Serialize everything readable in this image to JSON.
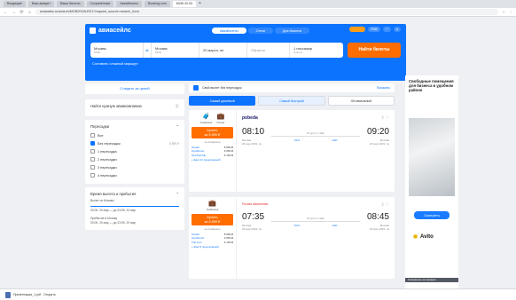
{
  "browser": {
    "tabs": [
      "Входящие",
      "Ваш аккаунт",
      "Ваши билеты",
      "Сохранённые",
      "Авиабилеты",
      "Booking.com",
      "МОВ 20.03"
    ],
    "url": "aviasales.ru/search/МОВ2003LED1?request_source=search_form"
  },
  "site": {
    "logo": "авиасейлс",
    "nav": [
      "Авиабилеты",
      "Отели",
      "Для бизнеса"
    ],
    "currency": "RUB",
    "search": {
      "from": "Москва",
      "from_code": "МОВ",
      "to": "Москва",
      "to_code": "МОВ",
      "date": "20 марта, пн",
      "return_placeholder": "Обратно",
      "passengers": "1 пассажир",
      "class": "эконом",
      "button": "Найти билеты"
    },
    "route_link": "Составить сложный маршрут"
  },
  "filters": {
    "subscribe": "Следить за ценой",
    "airlines": {
      "title": "Найти нужную авиакомпанию"
    },
    "transfers_title": "Пересадки",
    "transfers": [
      {
        "label": "Все",
        "price": "",
        "checked": false
      },
      {
        "label": "Без пересадок",
        "price": "8 899 ₽",
        "checked": true
      },
      {
        "label": "1 пересадка",
        "price": "",
        "checked": false
      },
      {
        "label": "2 пересадки",
        "price": "",
        "checked": false
      },
      {
        "label": "3 пересадки",
        "price": "",
        "checked": false
      },
      {
        "label": "4 пересадки",
        "price": "",
        "checked": false
      }
    ],
    "times_title": "Время вылета и прибытия",
    "times": {
      "row1": "Вылет из Москвы",
      "row1_range": "00:00, 20 мар — до 23:59, 20 мар",
      "row2": "Прибытие в Москву",
      "row2_range": "00:00, 20 мар — до 23:59, 20 мар"
    }
  },
  "results": {
    "note": "Свой вылет без пересадок",
    "note_action": "Показать",
    "sorts": [
      "Самый дешёвый",
      "Самый быстрый",
      "Оптимальный"
    ],
    "tickets": [
      {
        "agencies": [
          "Aviakassa",
          "Oneair"
        ],
        "buy": "Купить",
        "price": "за 8 899 ₽",
        "via": "на Aviakassa",
        "alts": [
          {
            "name": "Oneair",
            "price": "8 999 ₽"
          },
          {
            "name": "Купибилет",
            "price": "9 050 ₽"
          },
          {
            "name": "OneTwoTrip",
            "price": "9 100 ₽"
          }
        ],
        "more": "+ Ещё 12 предложений",
        "airline": "pobeda",
        "dep": "08:10",
        "arr": "09:20",
        "duration": "В пути 1ч 10м",
        "dep_city": "Москва",
        "dep_date": "20 мар 2023, пн",
        "dep_code": "VKO",
        "arr_city": "Москва",
        "arr_date": "20 мар 2023, пн",
        "arr_code": "LED"
      },
      {
        "agencies": [
          "Aviakassa"
        ],
        "buy": "Купить",
        "price": "за 8 899 ₽",
        "via": "на Aviakassa",
        "alts": [
          {
            "name": "Oneair",
            "price": "8 999 ₽"
          },
          {
            "name": "Купибилет",
            "price": "9 050 ₽"
          },
          {
            "name": "Trip.com",
            "price": "9 100 ₽"
          }
        ],
        "more": "+ Ещё 9 предложений",
        "airline": "Россия Авиалинии",
        "dep": "07:35",
        "arr": "08:45",
        "duration": "В пути 1ч 10м",
        "dep_city": "Москва",
        "dep_date": "20 мар 2023, пн",
        "dep_code": "SVO",
        "arr_city": "Москва",
        "arr_date": "20 мар 2023, пн",
        "arr_code": "LED"
      }
    ]
  },
  "ad": {
    "text": "Свободные помещения для бизнеса в удобном районе",
    "button": "Смотреть",
    "brand": "Avito"
  },
  "toast": "Сохранено на сервере",
  "download": {
    "file": "Презентация_1.pdf",
    "sub": "Открыть"
  }
}
